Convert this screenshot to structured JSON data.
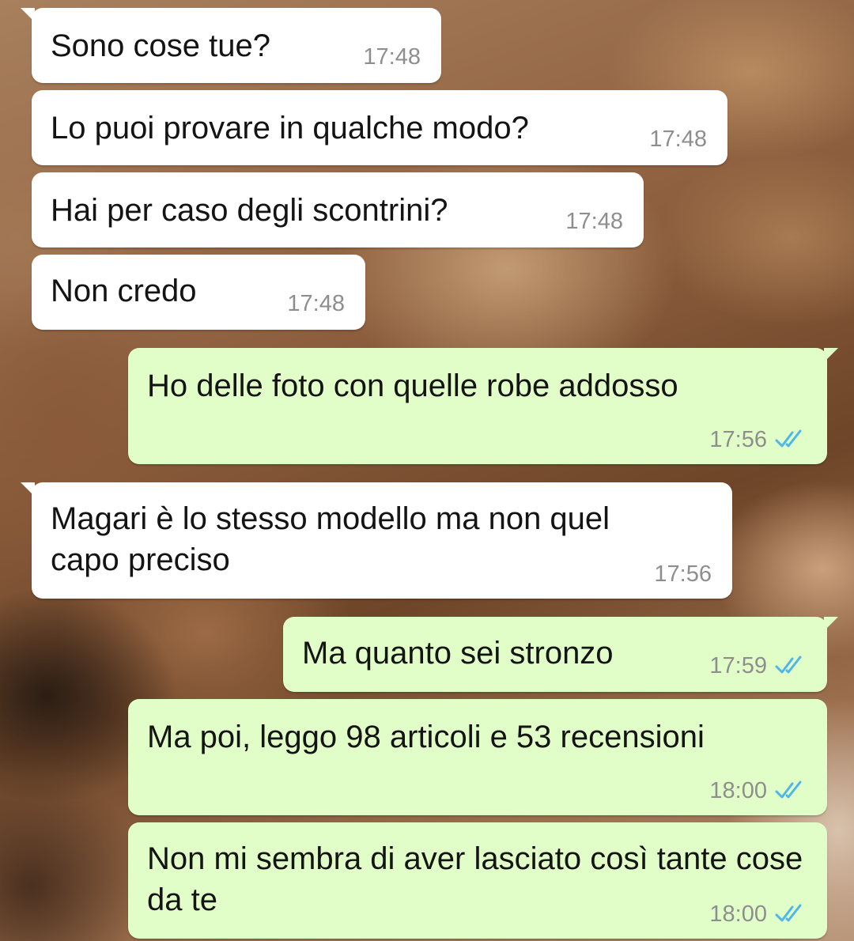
{
  "messages": [
    {
      "text": "Sono cose tue?",
      "time": "17:48",
      "direction": "incoming",
      "status": null
    },
    {
      "text": "Lo puoi provare in qualche modo?",
      "time": "17:48",
      "direction": "incoming",
      "status": null
    },
    {
      "text": "Hai per caso degli scontrini?",
      "time": "17:48",
      "direction": "incoming",
      "status": null
    },
    {
      "text": "Non credo",
      "time": "17:48",
      "direction": "incoming",
      "status": null
    },
    {
      "text": "Ho delle foto con quelle robe addosso",
      "time": "17:56",
      "direction": "outgoing",
      "status": "read"
    },
    {
      "text": "Magari è lo stesso modello ma non quel capo preciso",
      "time": "17:56",
      "direction": "incoming",
      "status": null
    },
    {
      "text": "Ma quanto sei stronzo",
      "time": "17:59",
      "direction": "outgoing",
      "status": "read"
    },
    {
      "text": "Ma poi, leggo 98 articoli e 53 recensioni",
      "time": "18:00",
      "direction": "outgoing",
      "status": "read"
    },
    {
      "text": "Non mi sembra di aver lasciato così tante cose da te",
      "time": "18:00",
      "direction": "outgoing",
      "status": "read"
    }
  ],
  "colors": {
    "incoming_bubble": "#ffffff",
    "outgoing_bubble": "#e2fec8",
    "timestamp": "#8e8e8e",
    "read_ticks": "#4fb6ec"
  },
  "icons": {
    "read_receipt": "double-check-icon"
  }
}
